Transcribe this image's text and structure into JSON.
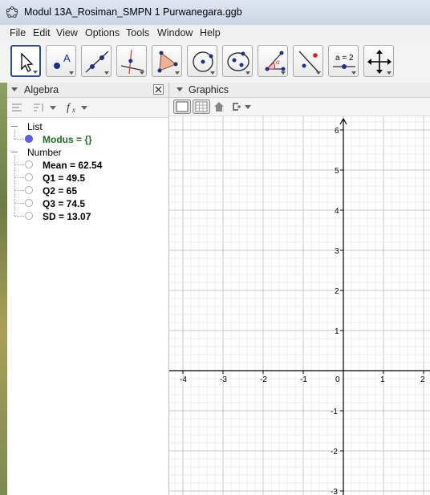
{
  "window": {
    "title": "Modul 13A_Rosiman_SMPN 1 Purwanegara.ggb"
  },
  "menu": [
    "File",
    "Edit",
    "View",
    "Options",
    "Tools",
    "Window",
    "Help"
  ],
  "toolbar": {
    "tools": [
      "move-tool",
      "point-tool",
      "line-tool",
      "perpendicular-tool",
      "polygon-tool",
      "circle-tool",
      "conic-tool",
      "angle-tool",
      "reflect-tool",
      "slider-tool",
      "move-graphics-tool"
    ],
    "slider_label": "a = 2"
  },
  "algebra": {
    "title": "Algebra",
    "list_group": "List",
    "modus": "Modus = {}",
    "number_group": "Number",
    "items": [
      "Mean = 62.54",
      "Q1 = 49.5",
      "Q2 = 65",
      "Q3 = 74.5",
      "SD = 13.07"
    ],
    "accent_color": "#1e6b1e"
  },
  "graphics": {
    "title": "Graphics",
    "x_tick_labels": [
      "-4",
      "-3",
      "-2",
      "-1",
      "0",
      "1",
      "2"
    ],
    "y_tick_labels": [
      "6",
      "5",
      "4",
      "3",
      "2",
      "1",
      "-1",
      "-2",
      "-3"
    ]
  }
}
